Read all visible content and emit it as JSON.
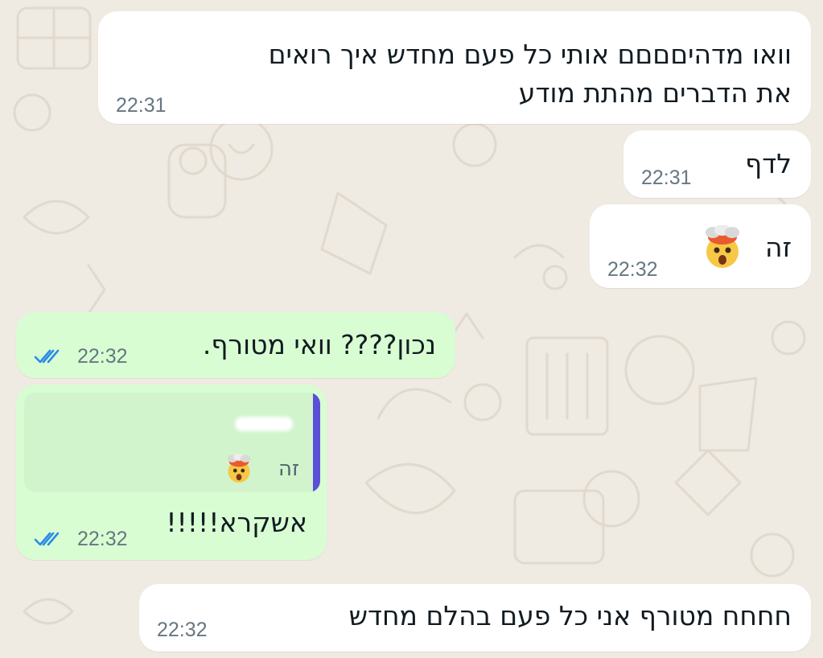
{
  "chat": {
    "messages": [
      {
        "direction": "incoming",
        "lines": [
          "וואו מדהיםםםם אותי כל פעם מחדש איך רואים",
          "את הדברים מהתת מודע"
        ],
        "time": "22:31"
      },
      {
        "direction": "incoming",
        "text": "לדף",
        "time": "22:31"
      },
      {
        "direction": "incoming",
        "text": "זה",
        "emoji": "exploding-head-emoji",
        "time": "22:32"
      },
      {
        "direction": "outgoing",
        "text": "נכון???? וואי מטורף.",
        "time": "22:32",
        "status": "read"
      },
      {
        "direction": "outgoing",
        "quote": {
          "text": "זה",
          "emoji": "exploding-head-emoji"
        },
        "text": "אשקרא!!!!!",
        "time": "22:32",
        "status": "read"
      },
      {
        "direction": "incoming",
        "text": "חחחח מטורף אני כל פעם בהלם מחדש",
        "time": "22:32"
      }
    ]
  },
  "colors": {
    "wallpaper": "#efeae2",
    "incoming_bubble": "#ffffff",
    "outgoing_bubble": "#d9fdd3",
    "quote_background": "#d1f4cc",
    "quote_bar": "#5b4fd8",
    "read_ticks": "#2a8be6",
    "timestamp": "#667781"
  }
}
